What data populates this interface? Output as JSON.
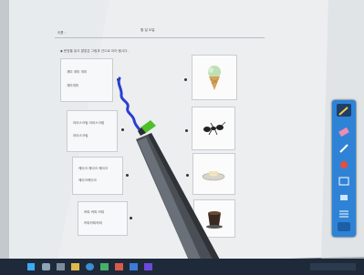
{
  "worksheet": {
    "header_left": "이름 :",
    "header_center": "월 일 요일",
    "instruction": "◆ 문장을 읽고 알맞은 그림과 선으로 이어 봅시다.",
    "left_items": [
      {
        "line1": "개미 개미 개미",
        "line2": "개미개미"
      },
      {
        "line1": "아이스크림 아이스크림",
        "line2": "아이스크림"
      },
      {
        "line1": "케이크 케이크 케이크",
        "line2": "케이크케이크"
      },
      {
        "line1": "커피 커피 커피",
        "line2": "커피커피커피"
      }
    ],
    "right_items": [
      {
        "picture": "ice-cream-cone"
      },
      {
        "picture": "ant"
      },
      {
        "picture": "cake-plate"
      },
      {
        "picture": "coffee-cup"
      }
    ]
  },
  "toolbar": {
    "tools": [
      "pen-tool",
      "eraser-tool",
      "highlighter-tool",
      "color-tool",
      "select-tool",
      "shape-tool",
      "menu-tool"
    ]
  },
  "taskbar": {
    "items": [
      "start",
      "search",
      "task-view",
      "file-explorer",
      "browser",
      "app",
      "app",
      "app",
      "app",
      "app"
    ]
  },
  "colors": {
    "screen_bg": "#eef0f2",
    "ink": "#2a3fd0",
    "pen_tip": "#4fbf2a",
    "toolbar": "#2f83d6",
    "taskbar": "#1e2a3a"
  }
}
